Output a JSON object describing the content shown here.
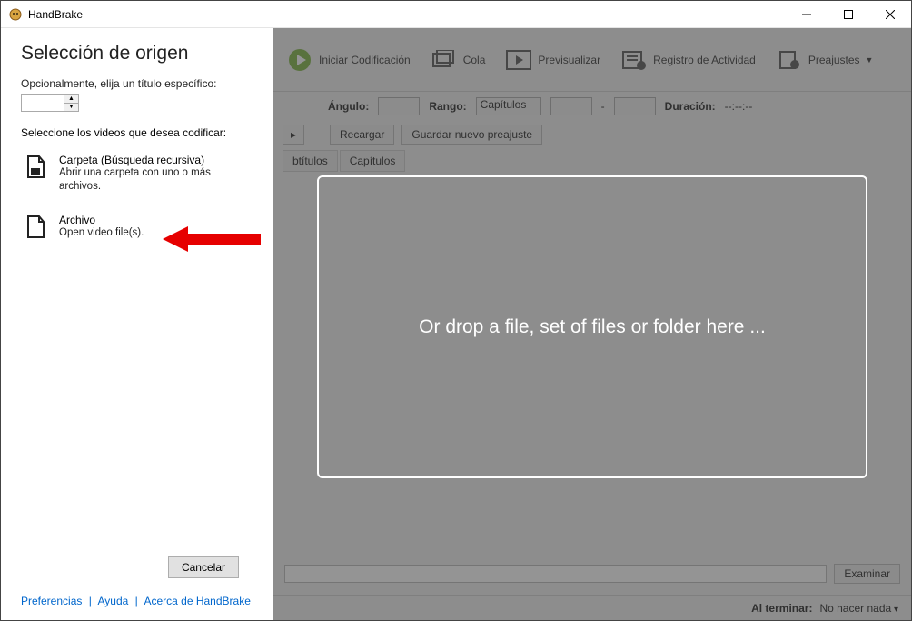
{
  "window": {
    "title": "HandBrake"
  },
  "left": {
    "heading": "Selección de origen",
    "specific_title_label": "Opcionalmente, elija un título específico:",
    "select_videos_label": "Seleccione los videos que desea codificar:",
    "folder": {
      "title": "Carpeta (Búsqueda recursiva)",
      "subtitle": "Abrir una carpeta con uno o más archivos."
    },
    "file": {
      "title": "Archivo",
      "subtitle": "Open video file(s)."
    },
    "cancel_label": "Cancelar",
    "links": {
      "prefs": "Preferencias",
      "help": "Ayuda",
      "about": "Acerca de HandBrake"
    }
  },
  "toolbar": {
    "start": "Iniciar Codificación",
    "queue": "Cola",
    "preview": "Previsualizar",
    "activity": "Registro de Actividad",
    "presets": "Preajustes"
  },
  "title_row": {
    "angle_label": "Ángulo:",
    "range_label": "Rango:",
    "range_value": "Capítulos",
    "dash": "-",
    "duration_label": "Duración:",
    "duration_value": "--:--:--"
  },
  "preset_row": {
    "reload": "Recargar",
    "save_new": "Guardar nuevo preajuste"
  },
  "tabs": {
    "subtitles": "btítulos",
    "chapters": "Capítulos"
  },
  "drop_message": "Or drop a file, set of files or folder here ...",
  "bottom": {
    "browse": "Examinar"
  },
  "status": {
    "when_done_label": "Al terminar:",
    "when_done_value": "No hacer nada"
  }
}
